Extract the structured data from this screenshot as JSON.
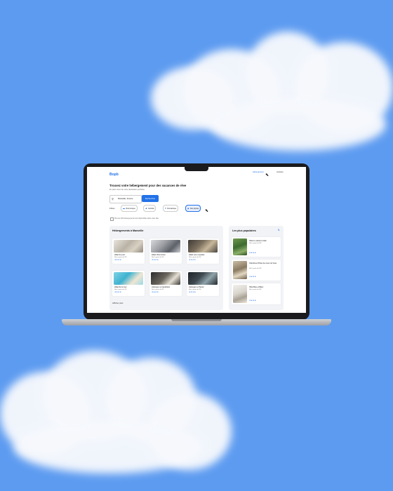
{
  "app": {
    "logo": "Bopb"
  },
  "nav": {
    "link_active": "Hébergement",
    "link_other": "Activités"
  },
  "hero": {
    "title": "Trouvez votre hébergement pour des vacances de rêve",
    "subtitle": "En plein cœur de votre destination préférée"
  },
  "search": {
    "location_value": "Marseille, France",
    "button_label": "Rechercher",
    "location_icon": "map-pin-icon"
  },
  "filters": {
    "label": "Filtres",
    "chips": [
      {
        "label": "Économique",
        "icon": "money-icon",
        "selected": false
      },
      {
        "label": "Familial",
        "icon": "people-icon",
        "selected": false
      },
      {
        "label": "Romantique",
        "icon": "heart-icon",
        "selected": false
      },
      {
        "label": "Nos pépites",
        "icon": "gem-icon",
        "selected": true
      }
    ],
    "checkbox_label": "Plus de 200 hébergements sont disponibles dans votre ville"
  },
  "listings": {
    "title": "Hébergements à Marseille",
    "price_note": "Nuit à partir de 25€",
    "items": [
      {
        "name": "Hôtel du port",
        "stars": "★★★★"
      },
      {
        "name": "Hôtel Chez Anna",
        "stars": "★★★★"
      },
      {
        "name": "Hôtel Les mouettes",
        "stars": "★★★★"
      },
      {
        "name": "Hôtel de la mer",
        "stars": "★★★★"
      },
      {
        "name": "Auberge La Canebière",
        "stars": "★★★★"
      },
      {
        "name": "Auberge Le Panier",
        "stars": "★★★★"
      }
    ],
    "more_label": "Afficher plus"
  },
  "popular": {
    "title": "Les plus populaires",
    "items": [
      {
        "name": "Hôtel Le soleil du matin",
        "price": "Nuit à partir de 30€",
        "stars": "★★★★"
      },
      {
        "name": "Chambres d'hôtes Au coeur de Vieux",
        "price": "Nuit à partir de 30€",
        "stars": "★★★★"
      },
      {
        "name": "Hôtel Bleu et Blanc",
        "price": "Nuit à partir de 30€",
        "stars": "★★★★"
      }
    ]
  },
  "colors": {
    "accent": "#2272e8",
    "sky": "#5d9bf0",
    "cloud": "#f7f9fd"
  }
}
